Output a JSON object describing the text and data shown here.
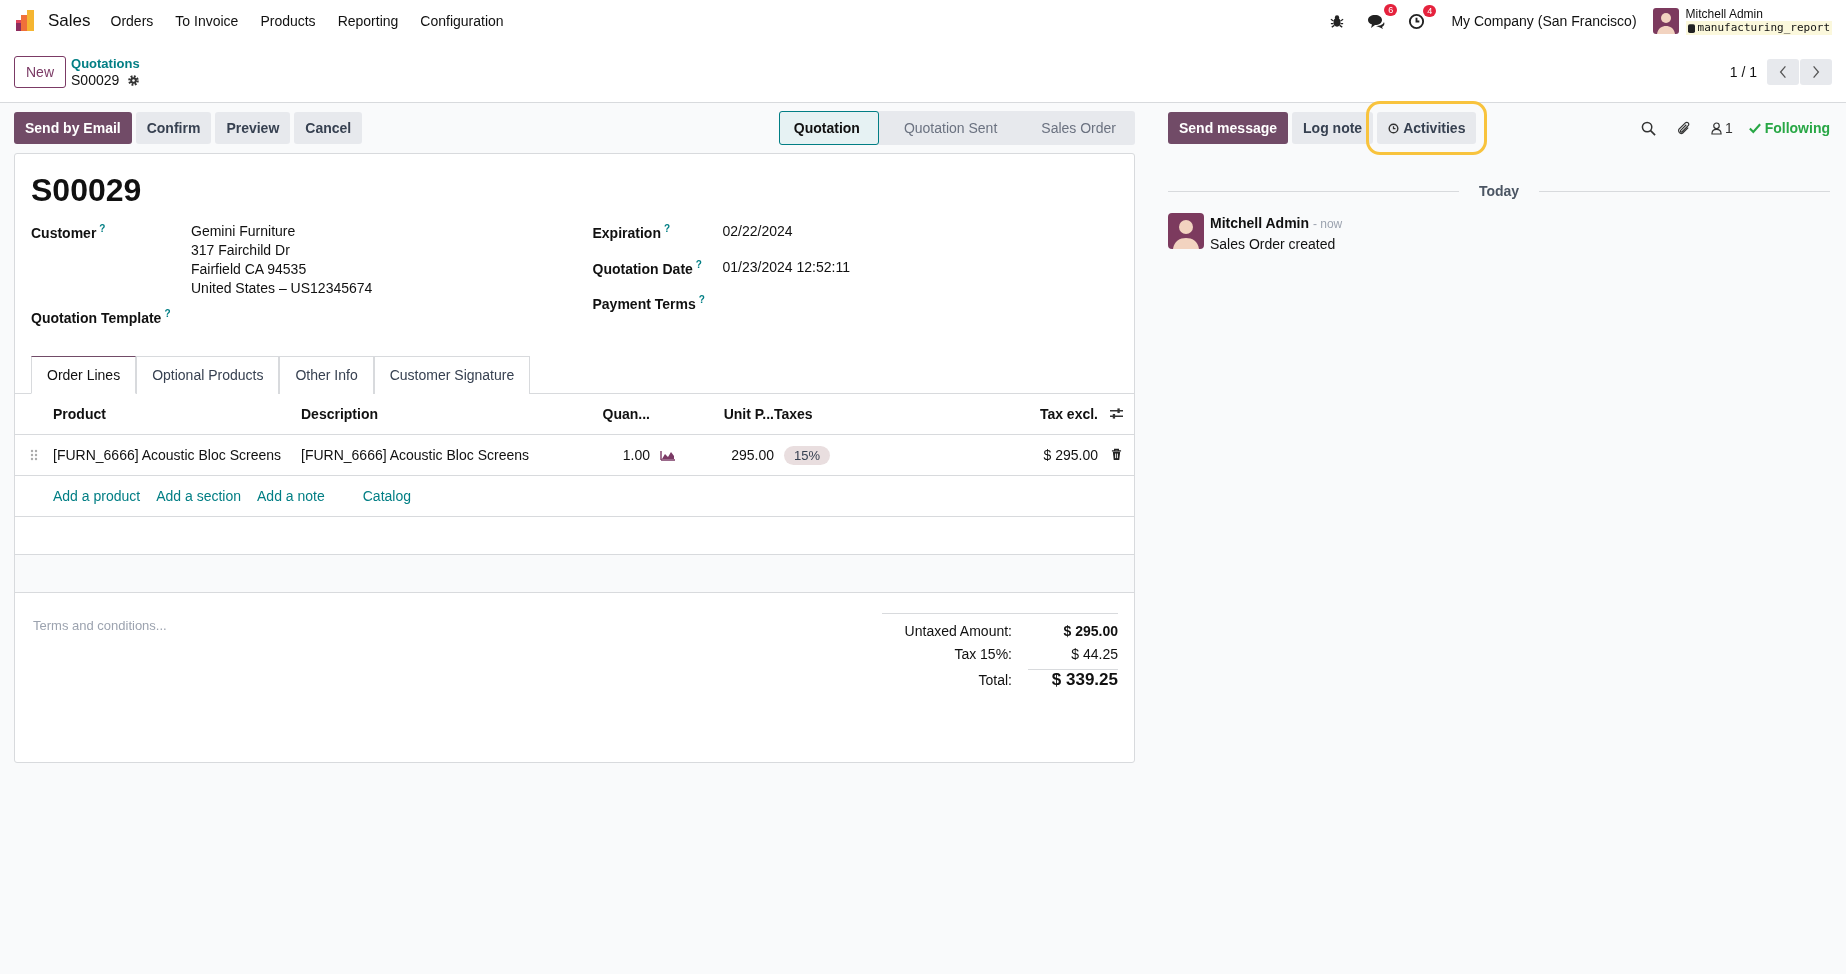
{
  "navbar": {
    "app_name": "Sales",
    "menu": [
      "Orders",
      "To Invoice",
      "Products",
      "Reporting",
      "Configuration"
    ],
    "messages_badge": "6",
    "activities_badge": "4",
    "company": "My Company (San Francisco)",
    "user": "Mitchell Admin",
    "database": "manufacturing_report"
  },
  "control_panel": {
    "new_button": "New",
    "breadcrumb": "Quotations",
    "record": "S00029",
    "pager": "1 / 1"
  },
  "actions": [
    {
      "label": "Send by Email",
      "kind": "primary"
    },
    {
      "label": "Confirm",
      "kind": "secondary"
    },
    {
      "label": "Preview",
      "kind": "secondary"
    },
    {
      "label": "Cancel",
      "kind": "secondary"
    }
  ],
  "status_steps": [
    {
      "label": "Quotation",
      "selected": true
    },
    {
      "label": "Quotation Sent",
      "selected": false
    },
    {
      "label": "Sales Order",
      "selected": false
    }
  ],
  "form": {
    "title": "S00029",
    "left_fields": [
      {
        "label": "Customer",
        "help": "?",
        "lines": [
          "Gemini Furniture",
          "317 Fairchild Dr",
          "Fairfield CA 94535",
          "United States – US12345674"
        ]
      },
      {
        "label": "Quotation Template",
        "help": "?"
      }
    ],
    "right_fields": [
      {
        "label": "Expiration",
        "help": "?",
        "lines": [
          "02/22/2024"
        ]
      },
      {
        "label": "Quotation Date",
        "help": "?",
        "lines": [
          "01/23/2024 12:52:11"
        ]
      },
      {
        "label": "Payment Terms",
        "help": "?"
      }
    ],
    "tabs": [
      {
        "label": "Order Lines",
        "selected": true
      },
      {
        "label": "Optional Products",
        "selected": false
      },
      {
        "label": "Other Info",
        "selected": false
      },
      {
        "label": "Customer Signature",
        "selected": false
      }
    ],
    "columns": [
      "Product",
      "Description",
      "Quan...",
      "Unit P...",
      "Taxes",
      "Tax excl."
    ],
    "rows": [
      {
        "product": "[FURN_6666] Acoustic Bloc Screens",
        "description": "[FURN_6666] Acoustic Bloc Screens",
        "quantity": "1.00",
        "unit_price": "295.00",
        "tax": "15%",
        "subtotal": "$ 295.00"
      }
    ],
    "add_links": [
      "Add a product",
      "Add a section",
      "Add a note",
      "Catalog"
    ],
    "terms": {
      "placeholder": "Terms and conditions..."
    },
    "totals": [
      {
        "label": "Untaxed Amount:",
        "value": "$ 295.00",
        "kind": "bold"
      },
      {
        "label": "Tax 15%:",
        "value": "$ 44.25",
        "kind": "plain"
      },
      {
        "label": "Total:",
        "value": "$ 339.25",
        "kind": "total"
      }
    ]
  },
  "chatter": {
    "buttons": [
      {
        "label": "Send message",
        "kind": "primary",
        "highlighted": false
      },
      {
        "label": "Log note",
        "kind": "secondary",
        "highlighted": false
      },
      {
        "label": "Activities",
        "kind": "activity",
        "highlighted": true
      }
    ],
    "follower_count": "1",
    "following": "Following",
    "date_separator": "Today",
    "messages": [
      {
        "author": "Mitchell Admin",
        "time": "- now",
        "body": "Sales Order created"
      }
    ]
  }
}
